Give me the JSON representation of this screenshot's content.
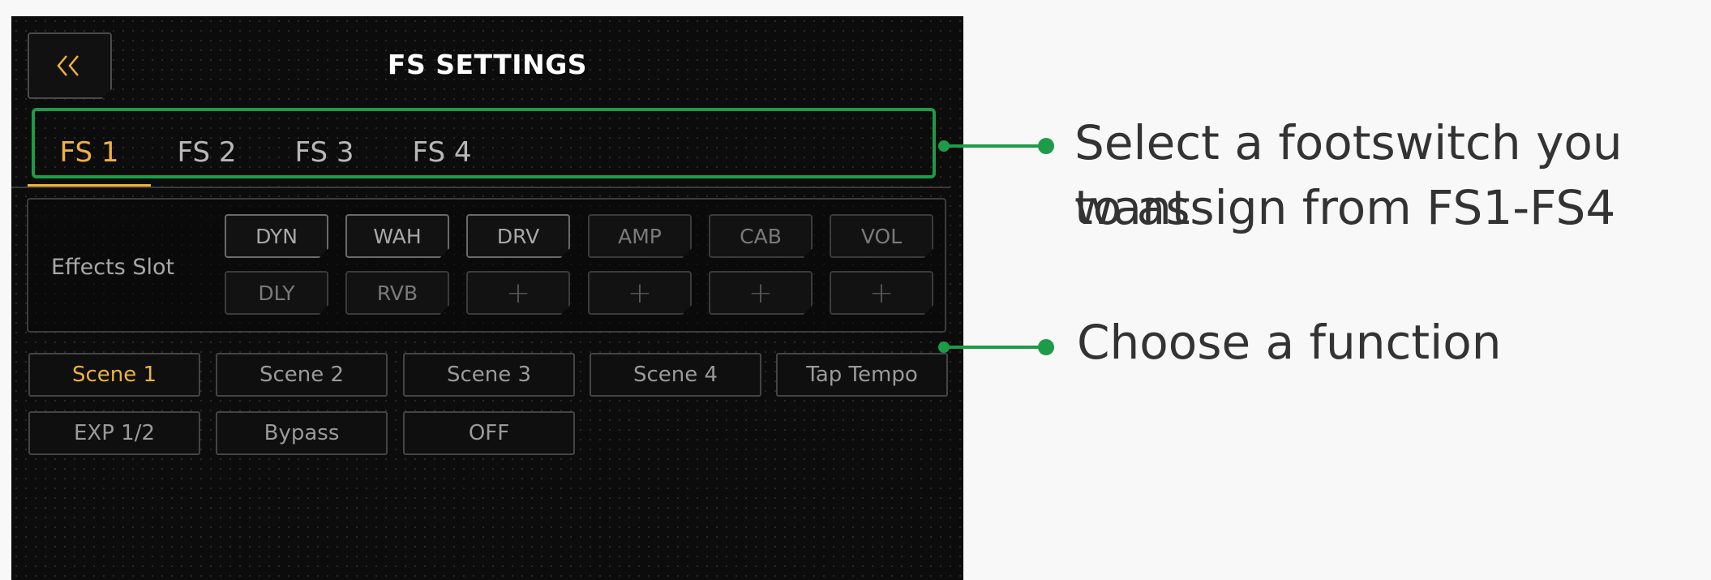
{
  "app": {
    "title": "FS SETTINGS",
    "back_glyph": "〈〈"
  },
  "tabs": [
    {
      "label": "FS 1",
      "active": true
    },
    {
      "label": "FS 2",
      "active": false
    },
    {
      "label": "FS 3",
      "active": false
    },
    {
      "label": "FS 4",
      "active": false
    }
  ],
  "effects": {
    "label": "Effects Slot",
    "row1": [
      "DYN",
      "WAH",
      "DRV",
      "AMP",
      "CAB",
      "VOL"
    ],
    "row2": [
      "DLY",
      "RVB",
      "+",
      "+",
      "+",
      "+"
    ]
  },
  "functions": {
    "row1": [
      "Scene 1",
      "Scene 2",
      "Scene 3",
      "Scene 4",
      "Tap Tempo"
    ],
    "row2": [
      "EXP 1/2",
      "Bypass",
      "OFF"
    ],
    "active": "Scene 1"
  },
  "callouts": {
    "footswitch_line1": "Select a footswitch you want",
    "footswitch_line2": "to assign from FS1-FS4",
    "function": "Choose a function"
  },
  "colors": {
    "accent": "#f0b23c",
    "callout": "#1e9b48",
    "background": "#0c0c0c"
  },
  "icons": {
    "back": "double-chevron-left-icon"
  }
}
